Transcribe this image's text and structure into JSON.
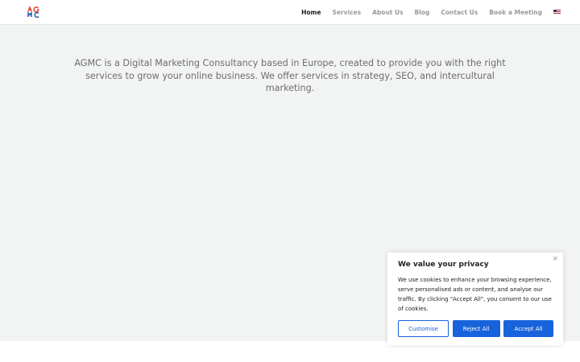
{
  "header": {
    "nav": [
      {
        "label": "Home",
        "active": true
      },
      {
        "label": "Services",
        "active": false
      },
      {
        "label": "About Us",
        "active": false
      },
      {
        "label": "Blog",
        "active": false
      },
      {
        "label": "Contact Us",
        "active": false
      },
      {
        "label": "Book a Meeting",
        "active": false
      }
    ],
    "flag_icon": "us-flag-icon"
  },
  "hero": {
    "intro": "AGMC is a Digital Marketing Consultancy based in Europe, created to provide you with the right services to grow your online business. We offer services in strategy, SEO, and intercultural marketing."
  },
  "cookie_banner": {
    "title": "We value your privacy",
    "body": "We use cookies to enhance your browsing experience, serve personalised ads or content, and analyse our traffic. By clicking \"Accept All\", you consent to our use of cookies.",
    "close_icon": "×",
    "customise_label": "Customise",
    "reject_label": "Reject All",
    "accept_label": "Accept All"
  },
  "colors": {
    "accent": "#1863dc",
    "hero_bg": "#f2f3f3",
    "nav_active": "#222222",
    "nav_inactive": "#9a9a9a"
  }
}
